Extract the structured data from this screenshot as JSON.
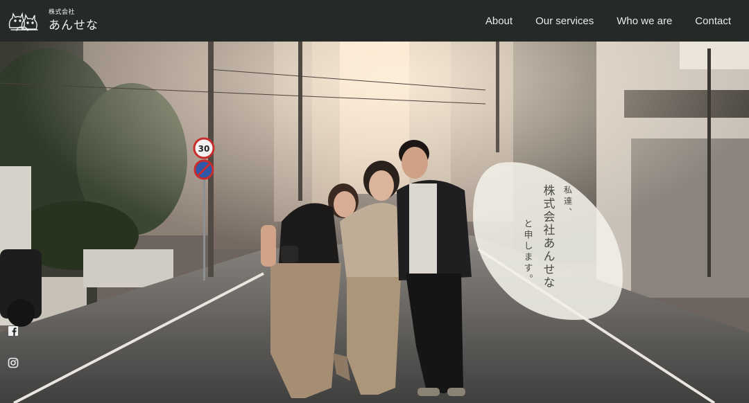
{
  "header": {
    "logo_small": "株式会社",
    "logo_name": "あんせな",
    "logo_icon": "cat-family-logo"
  },
  "nav": {
    "items": [
      {
        "label": "About"
      },
      {
        "label": "Our services"
      },
      {
        "label": "Who we are"
      },
      {
        "label": "Contact"
      }
    ]
  },
  "hero": {
    "bubble_line1": "私達、",
    "bubble_line2": "株式会社あんせな",
    "bubble_line3": "と申します。",
    "sign_speed": "30"
  },
  "social": {
    "facebook_icon": "facebook-icon",
    "instagram_icon": "instagram-icon"
  },
  "colors": {
    "header_bg": "#252a29",
    "text_light": "#eaeaea",
    "bubble_bg": "#f1f0e8"
  }
}
